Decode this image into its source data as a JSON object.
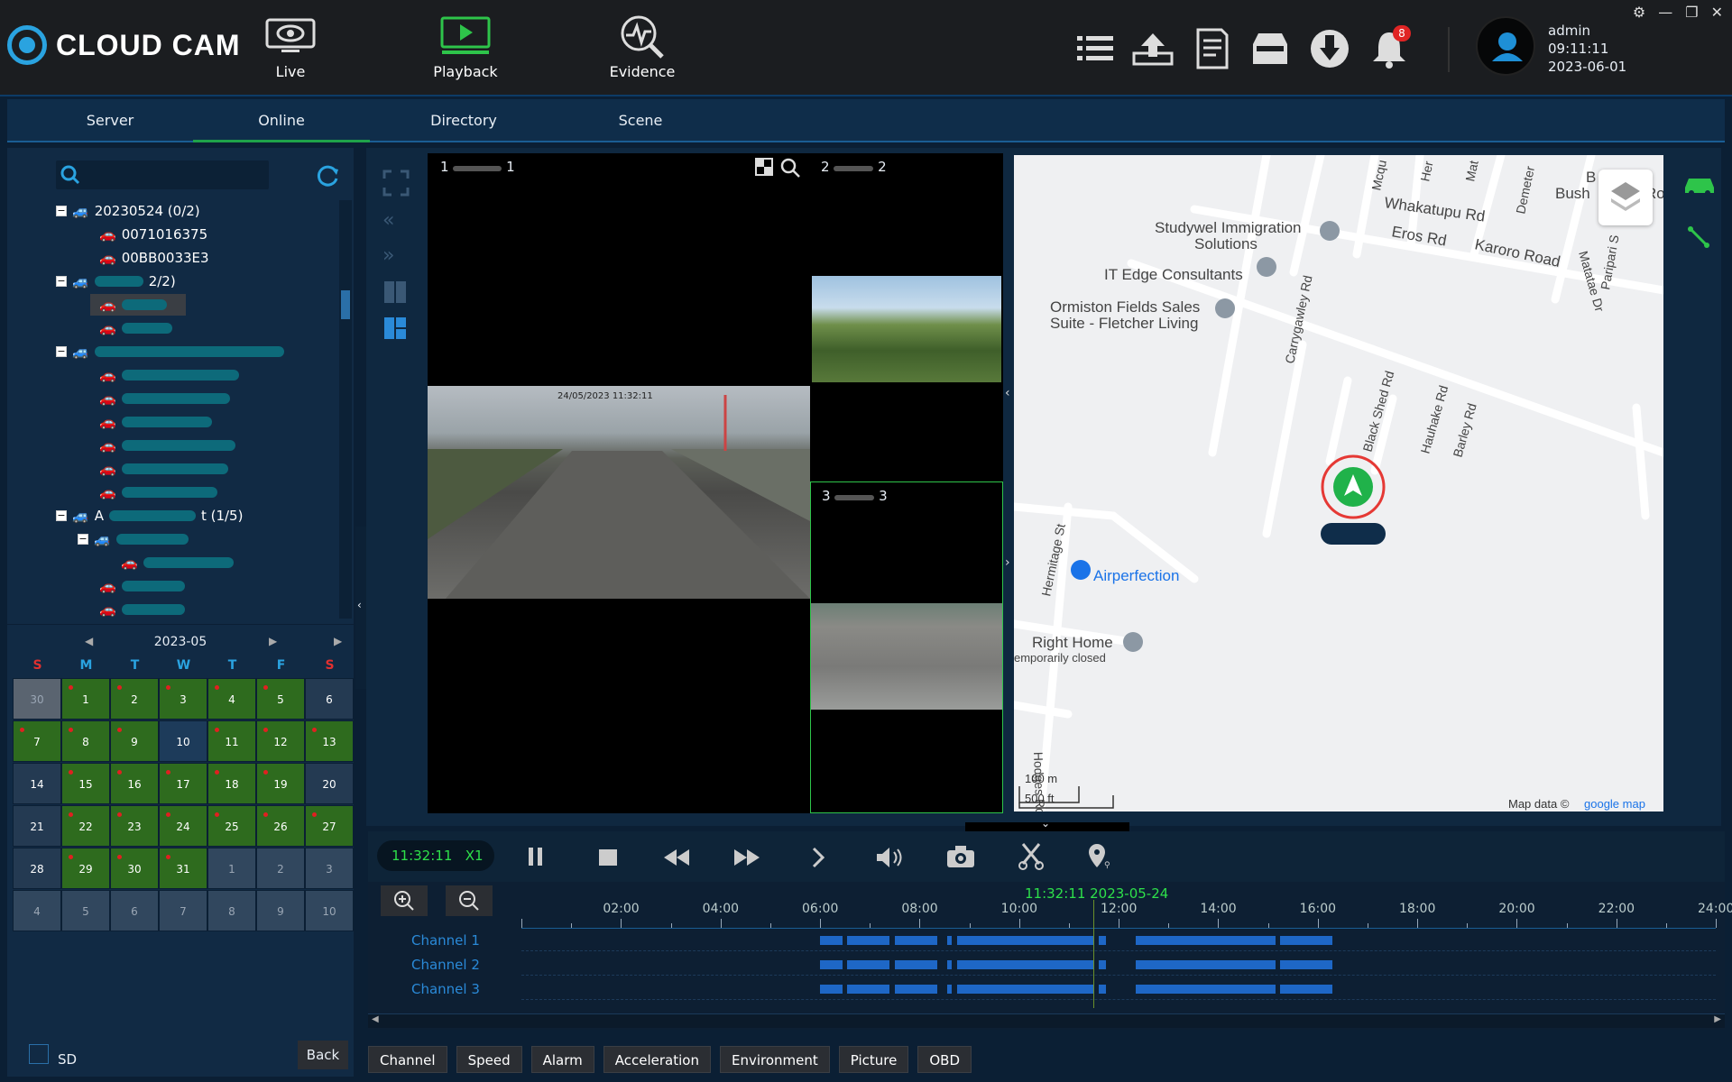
{
  "app": {
    "title": "CLOUD CAM"
  },
  "nav": {
    "live": "Live",
    "playback": "Playback",
    "evidence": "Evidence"
  },
  "toolbar": {
    "notification_count": "8",
    "icons": [
      "list-icon",
      "upload-icon",
      "report-icon",
      "inbox-icon",
      "download-icon",
      "bell-icon"
    ]
  },
  "user": {
    "name": "admin",
    "time": "09:11:11",
    "date": "2023-06-01"
  },
  "tabs": [
    "Server",
    "Online",
    "Directory",
    "Scene"
  ],
  "tree": {
    "group1": "20230524 (0/2)",
    "dev1": "0071016375",
    "dev2": "00BB0033E3",
    "group2_suffix": "2/2)",
    "group4_suffix": "t (1/5)",
    "group4_prefix": "A"
  },
  "calendar": {
    "month": "2023-05",
    "dow": [
      "S",
      "M",
      "T",
      "W",
      "T",
      "F",
      "S"
    ],
    "weeks": [
      [
        "30",
        "1",
        "2",
        "3",
        "4",
        "5",
        "6"
      ],
      [
        "7",
        "8",
        "9",
        "10",
        "11",
        "12",
        "13"
      ],
      [
        "14",
        "15",
        "16",
        "17",
        "18",
        "19",
        "20"
      ],
      [
        "21",
        "22",
        "23",
        "24",
        "25",
        "26",
        "27"
      ],
      [
        "28",
        "29",
        "30",
        "31",
        "1",
        "2",
        "3"
      ],
      [
        "4",
        "5",
        "6",
        "7",
        "8",
        "9",
        "10"
      ]
    ]
  },
  "left_bottom": {
    "sd": "SD",
    "back": "Back"
  },
  "video": {
    "ch1": "1",
    "ch2": "2",
    "ch3": "3",
    "ch1_label": "1",
    "ch2_label": "2",
    "ch3_label": "3",
    "stamp": "24/05/2023 11:32:11"
  },
  "map": {
    "labels": [
      "Whakatupu Rd",
      "Eros Rd",
      "Karoro Road",
      "Studywel Immigration",
      "Solutions",
      "IT Edge Consultants",
      "Ormiston Fields Sales",
      "Suite - Fletcher Living",
      "Carrygawley Rd",
      "Black Shed Rd",
      "Hauhake Rd",
      "Barley Rd",
      "Hermitage St",
      "Airperfection",
      "Right Home",
      "emporarily closed",
      "Hodges Rd",
      "Mcqu",
      "Her",
      "Mat",
      "Demeter",
      "Matatae Dr",
      "Paripari S",
      "Bush",
      "B",
      "Ro"
    ],
    "scale_m": "100 m",
    "scale_ft": "500 ft",
    "attribution": "Map data ©",
    "google": "google map"
  },
  "playback": {
    "time": "11:32:11",
    "speed": "X1"
  },
  "timeline": {
    "cursor": "11:32:11 2023-05-24",
    "hours": [
      "02:00",
      "04:00",
      "06:00",
      "08:00",
      "10:00",
      "12:00",
      "14:00",
      "16:00",
      "18:00",
      "20:00",
      "22:00",
      "24:00"
    ],
    "channels": [
      "Channel 1",
      "Channel 2",
      "Channel 3"
    ]
  },
  "bottom_tabs": [
    "Channel",
    "Speed",
    "Alarm",
    "Acceleration",
    "Environment",
    "Picture",
    "OBD"
  ],
  "colors": {
    "accent": "#1fa24a",
    "blue": "#2aa3e0",
    "segment": "#1e67c6",
    "calendar_green": "#2e6b1e"
  }
}
